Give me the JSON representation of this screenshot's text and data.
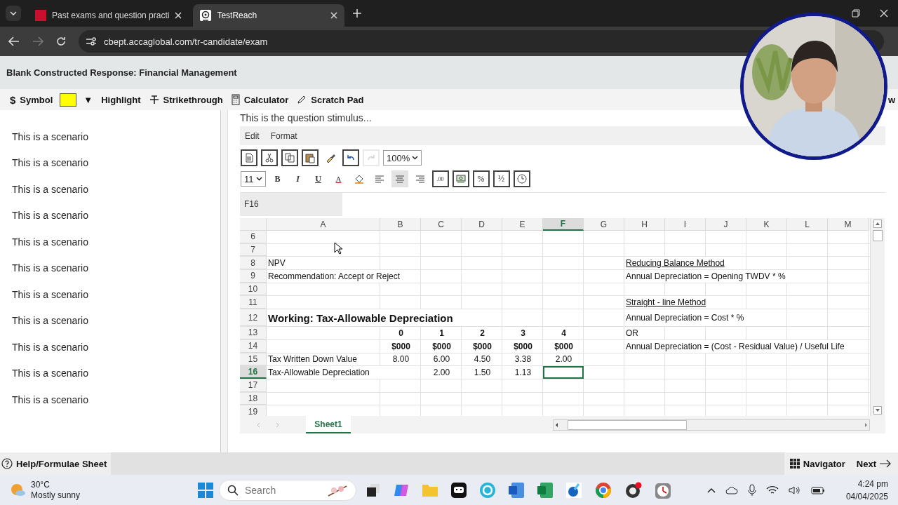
{
  "browser": {
    "tabs": [
      {
        "title": "Past exams and question practi",
        "selected": false
      },
      {
        "title": "TestReach",
        "selected": true
      }
    ],
    "url": "cbept.accaglobal.com/tr-candidate/exam"
  },
  "exam": {
    "title": "Blank Constructed Response: Financial Management",
    "toolbar": [
      {
        "kind": "symbol",
        "icon": "$",
        "label": "Symbol"
      },
      {
        "kind": "swatch",
        "color": "#ffff00",
        "label": "▼"
      },
      {
        "kind": "highlight",
        "label": "Highlight"
      },
      {
        "kind": "strike",
        "label": "Strikethrough"
      },
      {
        "kind": "calculator",
        "label": "Calculator"
      },
      {
        "kind": "scratch",
        "label": "Scratch Pad"
      },
      {
        "kind": "cut",
        "label": "w"
      }
    ],
    "scenarios": [
      "This is a scenario",
      "This is a scenario",
      "This is a scenario",
      "This is a scenario",
      "This is a scenario",
      "This is a scenario",
      "This is a scenario",
      "This is a scenario",
      "This is a scenario",
      "This is a scenario",
      "This is a scenario"
    ],
    "stimulus": "This is the question stimulus...",
    "sheet": {
      "menus": [
        "Edit",
        "Format"
      ],
      "tools_row1": [
        {
          "kind": "new",
          "disabled": false
        },
        {
          "kind": "cut",
          "disabled": false
        },
        {
          "kind": "copy",
          "disabled": false
        },
        {
          "kind": "paste",
          "disabled": false
        },
        {
          "kind": "painter",
          "disabled": false
        },
        {
          "kind": "undo",
          "disabled": false
        },
        {
          "kind": "redo",
          "disabled": true
        }
      ],
      "zoom": "100%",
      "font_size": "11",
      "tools_row2": [
        {
          "kind": "bold",
          "label": "B",
          "selected": false
        },
        {
          "kind": "italic",
          "label": "I",
          "selected": false
        },
        {
          "kind": "underline",
          "label": "U",
          "selected": false
        },
        {
          "kind": "font-color",
          "label": "A",
          "selected": false
        },
        {
          "kind": "fill",
          "selected": false
        },
        {
          "kind": "align-left",
          "selected": false
        },
        {
          "kind": "align-center",
          "selected": true
        },
        {
          "kind": "align-right",
          "selected": false
        },
        {
          "kind": "decimal",
          "label": ".00",
          "selected": false
        },
        {
          "kind": "currency",
          "selected": false
        },
        {
          "kind": "percent",
          "label": "%",
          "selected": false
        },
        {
          "kind": "fraction",
          "label": "½",
          "selected": false
        },
        {
          "kind": "time",
          "selected": false
        }
      ],
      "name_box": "F16",
      "columns": [
        {
          "name": "A",
          "selected": false
        },
        {
          "name": "B",
          "selected": false
        },
        {
          "name": "C",
          "selected": false
        },
        {
          "name": "D",
          "selected": false
        },
        {
          "name": "E",
          "selected": false
        },
        {
          "name": "F",
          "selected": true
        },
        {
          "name": "G",
          "selected": false
        },
        {
          "name": "H",
          "selected": false
        },
        {
          "name": "I",
          "selected": false
        },
        {
          "name": "J",
          "selected": false
        },
        {
          "name": "K",
          "selected": false
        },
        {
          "name": "L",
          "selected": false
        },
        {
          "name": "M",
          "selected": false
        }
      ],
      "rows": [
        {
          "number": "6",
          "selected": false
        },
        {
          "number": "7",
          "selected": false
        },
        {
          "number": "8",
          "selected": false,
          "cells": {
            "A": {
              "text": "NPV",
              "kind": "text"
            },
            "H": {
              "text": "Reducing Balance Method",
              "kind": "title"
            }
          }
        },
        {
          "number": "9",
          "selected": false,
          "cells": {
            "A": {
              "text": "Recommendation: Accept or Reject",
              "kind": "text"
            },
            "H": {
              "text": "Annual Depreciation = Opening TWDV * %",
              "kind": "text"
            }
          }
        },
        {
          "number": "10",
          "selected": false
        },
        {
          "number": "11",
          "selected": false,
          "cells": {
            "H": {
              "text": "Straight - line Method",
              "kind": "title"
            }
          }
        },
        {
          "number": "12",
          "selected": false,
          "cells": {
            "A": {
              "text": "Working: Tax-Allowable Depreciation",
              "kind": "heading"
            },
            "H": {
              "text": "Annual Depreciation = Cost * %",
              "kind": "text"
            }
          }
        },
        {
          "number": "13",
          "selected": false,
          "cells": {
            "B": {
              "text": "0",
              "kind": "header"
            },
            "C": {
              "text": "1",
              "kind": "header"
            },
            "D": {
              "text": "2",
              "kind": "header"
            },
            "E": {
              "text": "3",
              "kind": "header"
            },
            "F": {
              "text": "4",
              "kind": "header"
            },
            "H": {
              "text": "OR",
              "kind": "text"
            }
          }
        },
        {
          "number": "14",
          "selected": false,
          "cells": {
            "B": {
              "text": "$000",
              "kind": "header"
            },
            "C": {
              "text": "$000",
              "kind": "header"
            },
            "D": {
              "text": "$000",
              "kind": "header"
            },
            "E": {
              "text": "$000",
              "kind": "header"
            },
            "F": {
              "text": "$000",
              "kind": "header"
            },
            "H": {
              "text": "Annual Depreciation = (Cost - Residual Value) / Useful Life",
              "kind": "text"
            }
          }
        },
        {
          "number": "15",
          "selected": false,
          "cells": {
            "A": {
              "text": "Tax Written Down Value",
              "kind": "text"
            },
            "B": {
              "text": "8.00",
              "kind": "number"
            },
            "C": {
              "text": "6.00",
              "kind": "number"
            },
            "D": {
              "text": "4.50",
              "kind": "number"
            },
            "E": {
              "text": "3.38",
              "kind": "number"
            },
            "F": {
              "text": "2.00",
              "kind": "number"
            }
          }
        },
        {
          "number": "16",
          "selected": true,
          "cells": {
            "A": {
              "text": "Tax-Allowable Depreciation",
              "kind": "text"
            },
            "C": {
              "text": "2.00",
              "kind": "number"
            },
            "D": {
              "text": "1.50",
              "kind": "number"
            },
            "E": {
              "text": "1.13",
              "kind": "number"
            }
          }
        },
        {
          "number": "17",
          "selected": false
        },
        {
          "number": "18",
          "selected": false
        },
        {
          "number": "19",
          "selected": false
        }
      ],
      "sheets": [
        {
          "name": "Sheet1",
          "selected": true
        }
      ]
    },
    "footer": {
      "help": "Help/Formulae Sheet",
      "navigator": "Navigator",
      "next": "Next"
    }
  },
  "taskbar": {
    "weather": {
      "temp": "30°C",
      "condition": "Mostly sunny"
    },
    "search": {
      "placeholder": "Search"
    },
    "time": "4:24 pm",
    "date": "04/04/2025"
  }
}
